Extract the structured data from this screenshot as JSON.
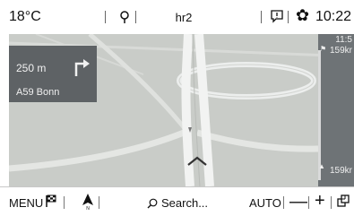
{
  "status_bar": {
    "temperature": "18°C",
    "title": "hr2",
    "time": "10:22",
    "icons": [
      "phone-icon",
      "message-icon",
      "gear-icon"
    ]
  },
  "guidance": {
    "distance": "250 m",
    "road": "A59 Bonn",
    "maneuver_icon": "turn-right-arrow-icon"
  },
  "route_panel": {
    "time": "11:5",
    "distance_top": "159kr",
    "distance_bottom": "159kr"
  },
  "bottom_bar": {
    "menu_label": "MENU",
    "search_label": "Search...",
    "zoom_mode": "AUTO",
    "minus": "—",
    "plus": "+",
    "icons": [
      "destination-flag-icon",
      "north-up-icon",
      "search-icon",
      "layers-icon"
    ]
  },
  "colors": {
    "map_background": "#c9ccc8",
    "panel": "#5e6265",
    "route": "#e8e9e7"
  }
}
